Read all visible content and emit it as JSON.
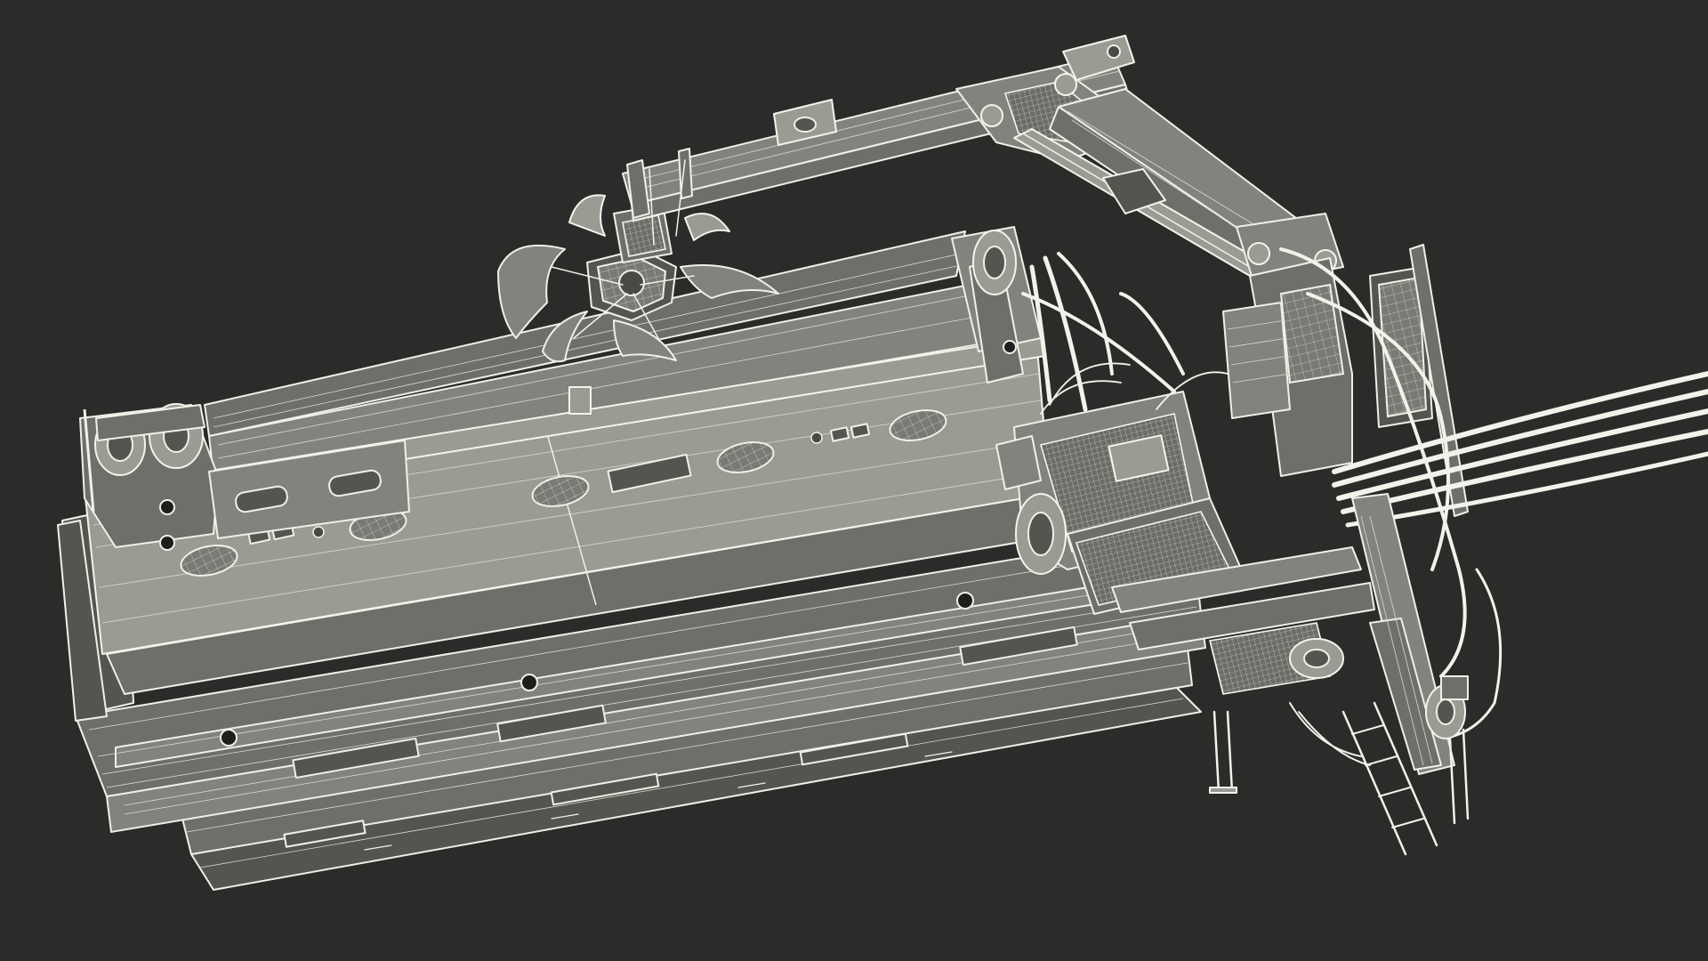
{
  "scene": {
    "background_color": "#2b2b2a",
    "wireframe_color": "#f2f1ea",
    "surface_color": "#6f6f6a"
  }
}
